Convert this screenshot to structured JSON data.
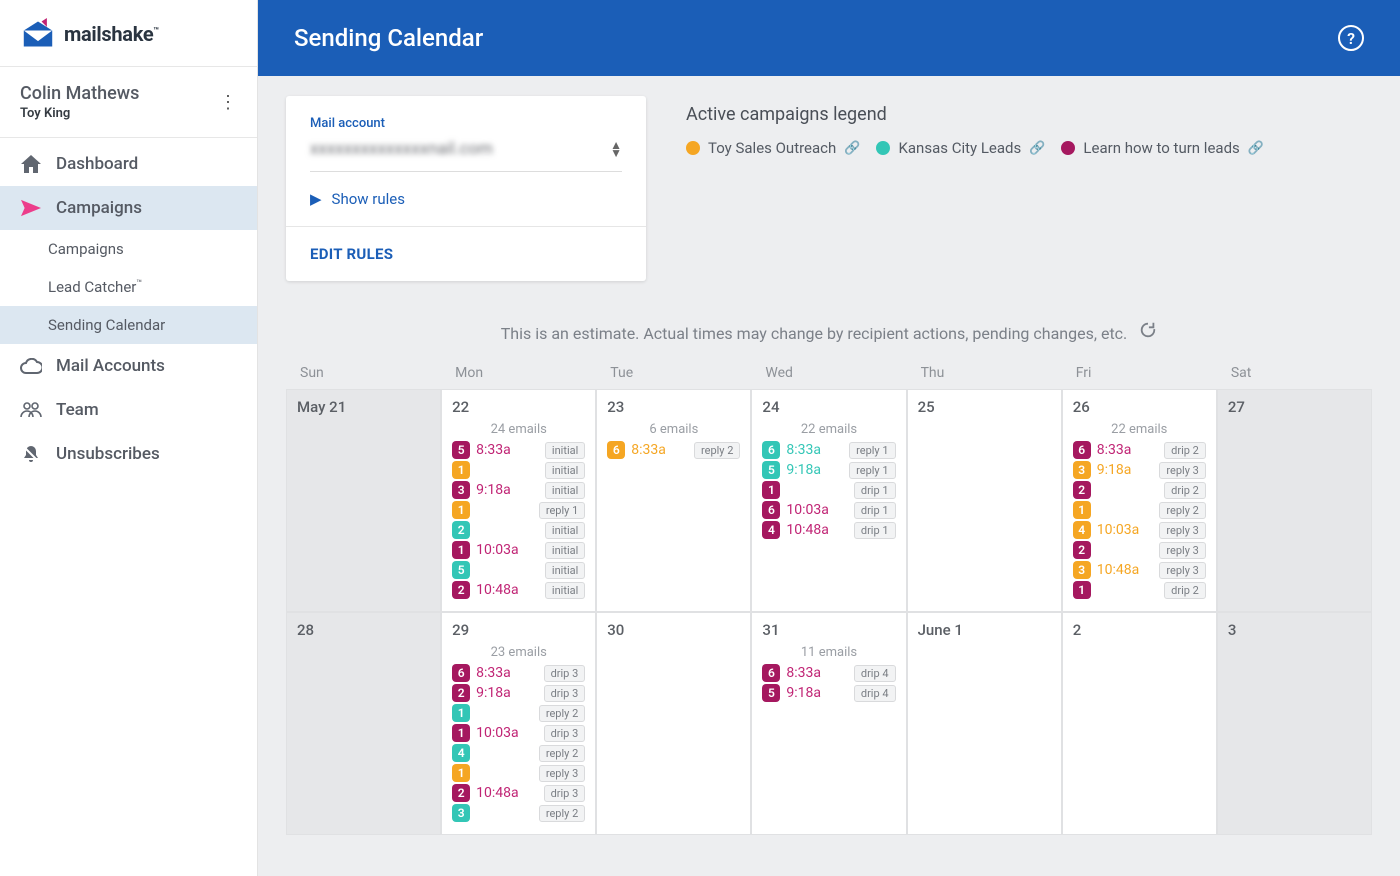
{
  "brand": "mailshake",
  "user": {
    "name": "Colin Mathews",
    "org": "Toy King"
  },
  "nav": {
    "dashboard": "Dashboard",
    "campaigns": "Campaigns",
    "sub_campaigns": "Campaigns",
    "sub_leadcatcher": "Lead Catcher",
    "sub_sending": "Sending Calendar",
    "mail_accounts": "Mail Accounts",
    "team": "Team",
    "unsubscribes": "Unsubscribes"
  },
  "header": {
    "title": "Sending Calendar"
  },
  "card": {
    "label": "Mail account",
    "value": "xxxxxxxxxxxxxxnail.com",
    "show_rules": "Show rules",
    "edit_rules": "EDIT RULES"
  },
  "legend": {
    "title": "Active campaigns legend",
    "items": [
      {
        "label": "Toy Sales Outreach",
        "color": "#f5a623"
      },
      {
        "label": "Kansas City Leads",
        "color": "#33c6b6"
      },
      {
        "label": "Learn how to turn leads",
        "color": "#a5185f"
      }
    ]
  },
  "estimate": "This is an estimate. Actual times may change by recipient actions, pending changes, etc.",
  "dow": [
    "Sun",
    "Mon",
    "Tue",
    "Wed",
    "Thu",
    "Fri",
    "Sat"
  ],
  "weeks": [
    [
      {
        "label": "May  21",
        "shade": true
      },
      {
        "label": "22",
        "summary": "24 emails",
        "events": [
          {
            "n": "5",
            "c": "magenta",
            "time": "8:33a",
            "tag": "initial"
          },
          {
            "n": "1",
            "c": "orange",
            "time": "",
            "tag": "initial"
          },
          {
            "n": "3",
            "c": "magenta",
            "time": "9:18a",
            "tag": "initial"
          },
          {
            "n": "1",
            "c": "orange",
            "time": "",
            "tag": "reply 1"
          },
          {
            "n": "2",
            "c": "teal",
            "time": "",
            "tag": "initial"
          },
          {
            "n": "1",
            "c": "magenta",
            "time": "10:03a",
            "tag": "initial"
          },
          {
            "n": "5",
            "c": "teal",
            "time": "",
            "tag": "initial"
          },
          {
            "n": "2",
            "c": "magenta",
            "time": "10:48a",
            "tag": "initial"
          }
        ]
      },
      {
        "label": "23",
        "summary": "6 emails",
        "events": [
          {
            "n": "6",
            "c": "orange",
            "time": "8:33a",
            "tag": "reply 2"
          }
        ]
      },
      {
        "label": "24",
        "summary": "22 emails",
        "events": [
          {
            "n": "6",
            "c": "teal",
            "time": "8:33a",
            "tag": "reply 1"
          },
          {
            "n": "5",
            "c": "teal",
            "time": "9:18a",
            "tag": "reply 1"
          },
          {
            "n": "1",
            "c": "magenta",
            "time": "",
            "tag": "drip 1"
          },
          {
            "n": "6",
            "c": "magenta",
            "time": "10:03a",
            "tag": "drip 1"
          },
          {
            "n": "4",
            "c": "magenta",
            "time": "10:48a",
            "tag": "drip 1"
          }
        ]
      },
      {
        "label": "25"
      },
      {
        "label": "26",
        "summary": "22 emails",
        "events": [
          {
            "n": "6",
            "c": "magenta",
            "time": "8:33a",
            "tag": "drip 2"
          },
          {
            "n": "3",
            "c": "orange",
            "time": "9:18a",
            "tag": "reply 3"
          },
          {
            "n": "2",
            "c": "magenta",
            "time": "",
            "tag": "drip 2"
          },
          {
            "n": "1",
            "c": "orange",
            "time": "",
            "tag": "reply 2"
          },
          {
            "n": "4",
            "c": "orange",
            "time": "10:03a",
            "tag": "reply 3"
          },
          {
            "n": "2",
            "c": "magenta",
            "time": "",
            "tag": "reply 3"
          },
          {
            "n": "3",
            "c": "orange",
            "time": "10:48a",
            "tag": "reply 3"
          },
          {
            "n": "1",
            "c": "magenta",
            "time": "",
            "tag": "drip 2"
          }
        ]
      },
      {
        "label": "27",
        "shade": true
      }
    ],
    [
      {
        "label": "28",
        "shade": true
      },
      {
        "label": "29",
        "summary": "23 emails",
        "events": [
          {
            "n": "6",
            "c": "magenta",
            "time": "8:33a",
            "tag": "drip 3"
          },
          {
            "n": "2",
            "c": "magenta",
            "time": "9:18a",
            "tag": "drip 3"
          },
          {
            "n": "1",
            "c": "teal",
            "time": "",
            "tag": "reply 2"
          },
          {
            "n": "1",
            "c": "magenta",
            "time": "10:03a",
            "tag": "drip 3"
          },
          {
            "n": "4",
            "c": "teal",
            "time": "",
            "tag": "reply 2"
          },
          {
            "n": "1",
            "c": "orange",
            "time": "",
            "tag": "reply 3"
          },
          {
            "n": "2",
            "c": "magenta",
            "time": "10:48a",
            "tag": "drip 3"
          },
          {
            "n": "3",
            "c": "teal",
            "time": "",
            "tag": "reply 2"
          }
        ]
      },
      {
        "label": "30"
      },
      {
        "label": "31",
        "summary": "11 emails",
        "events": [
          {
            "n": "6",
            "c": "magenta",
            "time": "8:33a",
            "tag": "drip 4"
          },
          {
            "n": "5",
            "c": "magenta",
            "time": "9:18a",
            "tag": "drip 4"
          }
        ]
      },
      {
        "label": "June  1"
      },
      {
        "label": "2"
      },
      {
        "label": "3",
        "shade": true
      }
    ]
  ]
}
